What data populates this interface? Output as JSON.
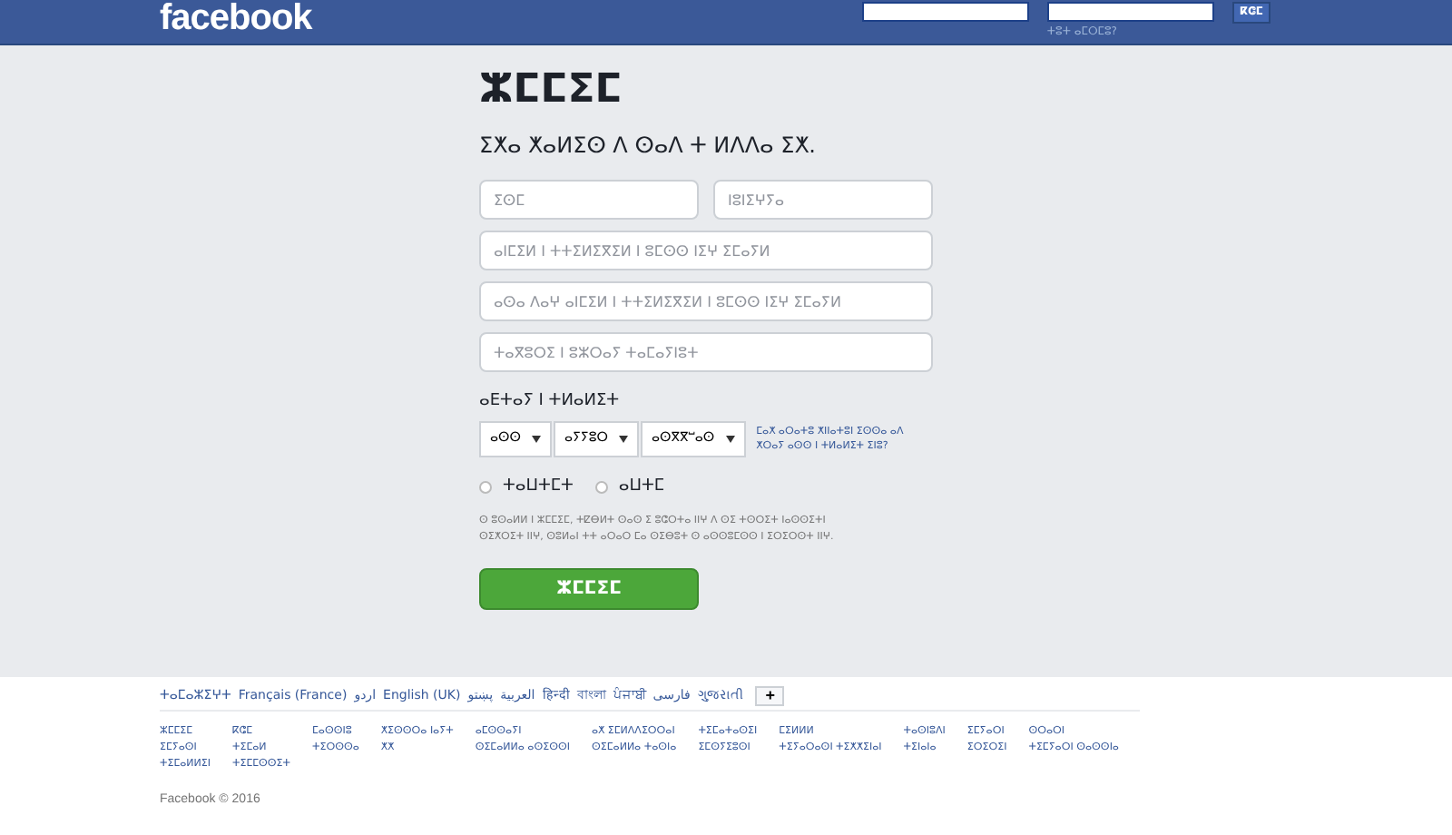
{
  "header": {
    "logo": "facebook",
    "login_button": "ⴽⵛⵎ",
    "forgot_link": "ⵜⵓⵜ ⴰⵎⵔⵎⵓ?"
  },
  "signup": {
    "title": "ⵣⵎⵎⵉⵎ",
    "subtitle": "ⵉⵅⴰ ⵅⴰⵍⵉⵙ ⴷ ⵙⴰⴷ ⵜ ⵍⴷⴷⴰ ⵉⵅ.",
    "fields": [
      {
        "placeholder": "ⵉⵙⵎ"
      },
      {
        "placeholder": "ⵏⵓⵏⵉⵖⵢⴰ"
      },
      {
        "placeholder": "ⴰⵏⵎⵉⵍ ⵏ ⵜⵜⵉⵍⵉⴳⵉⵍ ⵏ ⵓⵎⵙⵙ ⵏⵉⵖ ⵉⵎⴰⵢⵍ"
      },
      {
        "placeholder": "ⴰⵙⴰ ⴷⴰⵖ ⴰⵏⵎⵉⵍ ⵏ ⵜⵜⵉⵍⵉⴳⵉⵍ ⵏ ⵓⵎⵙⵙ ⵏⵉⵖ ⵉⵎⴰⵢⵍ"
      },
      {
        "placeholder": "ⵜⴰⴳⵓⵔⵉ ⵏ ⵓⵣⵔⴰⵢ ⵜⴰⵎⴰⵢⵏⵓⵜ"
      }
    ],
    "birthday_label": "ⴰⴹⵜⴰⵢ ⵏ ⵜⵍⴰⵍⵉⵜ",
    "selects": [
      {
        "value": "ⴰⵙⵙ"
      },
      {
        "value": "ⴰⵢⵢⵓⵔ"
      },
      {
        "value": "ⴰⵙⴳⴳⵯⴰⵙ"
      }
    ],
    "birthday_help": "ⵎⴰⵅ ⴰⵔⴰⵜⵓ ⵅⵏⵏⴰⵜⵓⵏ ⵉⵙⵙⴰ ⴰⴷ ⵅⵔⴰⵢ ⴰⵙⵙ ⵏ ⵜⵍⴰⵍⵉⵜ ⵉⵏⵓ?",
    "genders": [
      {
        "label": "ⵜⴰⵡⵜⵎⵜ",
        "selected": false
      },
      {
        "label": "ⴰⵡⵜⵎ",
        "selected": false
      }
    ],
    "terms": "ⵙ ⵓⵙⴰⵍⵍ ⵏ ⵣⵎⵎⵉⵎ, ⵜⵇⴱⵍⵜ ⵙⴰⵙ ⵉ ⵓⵛⵔⵜⴰ ⵏⵏⵖ ⴷ ⵙⵉ ⵜⵙⵔⵉⵜ ⵏⴰⵙⵙⵉⵜⵏ ⵙⵉⵅⵔⵉⵜ ⵏⵏⵖ, ⵙⵓⵍⴰⵏ ⵜⵜ ⴰⵔⴰⵔ ⵎⴰ ⵙⵉⴱⵓⵜ ⵙ ⴰⵙⵙⵓⵎⵙⵙ ⵏ ⵉⵔⵉⵔⵙⵜ ⵏⵏⵖ.",
    "submit": "ⵣⵎⵎⵉⵎ"
  },
  "footer": {
    "languages": [
      "ⵜⴰⵎⴰⵣⵉⵖⵜ",
      "Français (France)",
      "اردو",
      "English (UK)",
      "پښتو",
      "العربية",
      "हिन्दी",
      "বাংলা",
      "ਪੰਜਾਬੀ",
      "فارسی",
      "ગુજરાતી"
    ],
    "more_button": "+",
    "links": [
      [
        "ⵣⵎⵎⵉⵎ",
        "ⵉⵎⵢⴰⵙⵏ",
        "ⵜⵉⵎⴰⵍⵍⵉⵏ"
      ],
      [
        "ⴽⵛⵎ",
        "ⵜⵉⵎⴰⵍ",
        "ⵜⵉⵎⵎⵙⵙⵉⵜ"
      ],
      [
        "ⵎⴰⵙⵙⵏⵓ",
        "ⵜⵉⵔⵙⵙⴰ"
      ],
      [
        "ⵅⵉⵙⵙⵔⴰ ⵏⴰⵢⵜ",
        "ⵅⵅ"
      ],
      [
        "ⴰⵎⵙⵙⴰⵢⵏ",
        "ⵙⵉⵎⴰⵍⵍⴰ ⴰⵙⵉⵙⵙⵏ"
      ],
      [
        "ⴰⵅ ⵉⵎⵍⴷⴷⵉⵔⵔⴰⵏ",
        "ⵙⵉⵎⴰⵍⵍⴰ ⵜⴰⵙⵏⴰ"
      ],
      [
        "ⵜⵉⵎⴰⵜⴰⵙⵉⵏ",
        "ⵉⵎⵙⵢⵉⵓⵙⵏ"
      ],
      [
        "ⵎⵉⵍⵍⵍ",
        "ⵜⵉⵢⴰⵔⴰⵙⵏ ⵜⵉⵅⵅⵉⵏⴰⵏ"
      ],
      [
        "ⵜⴰⵙⵏⵓⴷⵏ",
        "ⵜⵉⵏⴰⵏⴰ"
      ],
      [
        "ⵉⵎⵢⴰⵔⵏ",
        "ⵉⵔⵉⵔⵉⵏ"
      ],
      [
        "ⵙⵔⴰⵔⵏ",
        "ⵜⵉⵎⵢⴰⵔⵏ ⵙⴰⵙⵙⵏⴰ"
      ]
    ],
    "copyright": "Facebook © 2016"
  }
}
